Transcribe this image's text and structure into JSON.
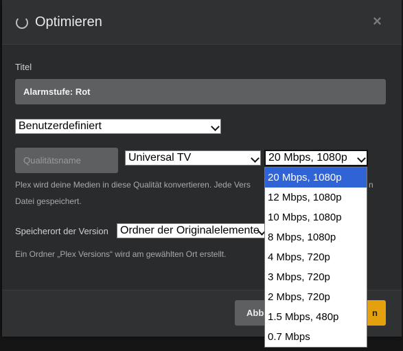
{
  "dialog": {
    "title": "Optimieren",
    "close_glyph": "×"
  },
  "form": {
    "title_label": "Titel",
    "title_value": "Alarmstufe: Rot",
    "preset_value": "Benutzerdefiniert",
    "quality_name_placeholder": "Qualitätsname",
    "device_value": "Universal TV",
    "bitrate_value": "20 Mbps, 1080p",
    "help_line1": "Plex wird deine Medien in diese Qualität konvertieren. Jede Vers",
    "help_line1_tail": "n",
    "help_line2": "Datei gespeichert.",
    "location_label": "Speicherort der Version",
    "location_value": "Ordner der Originalelemente",
    "location_help": "Ein Ordner „Plex Versions“ wird am gewählten Ort erstellt."
  },
  "footer": {
    "cancel_label_visible": "Abb",
    "save_label_visible": "n"
  },
  "bitrate_options": [
    "20 Mbps, 1080p",
    "12 Mbps, 1080p",
    "10 Mbps, 1080p",
    "8 Mbps, 1080p",
    "4 Mbps, 720p",
    "3 Mbps, 720p",
    "2 Mbps, 720p",
    "1.5 Mbps, 480p",
    "0.7 Mbps"
  ],
  "colors": {
    "accent": "#e5a00d",
    "selected_option": "#3063d6"
  }
}
